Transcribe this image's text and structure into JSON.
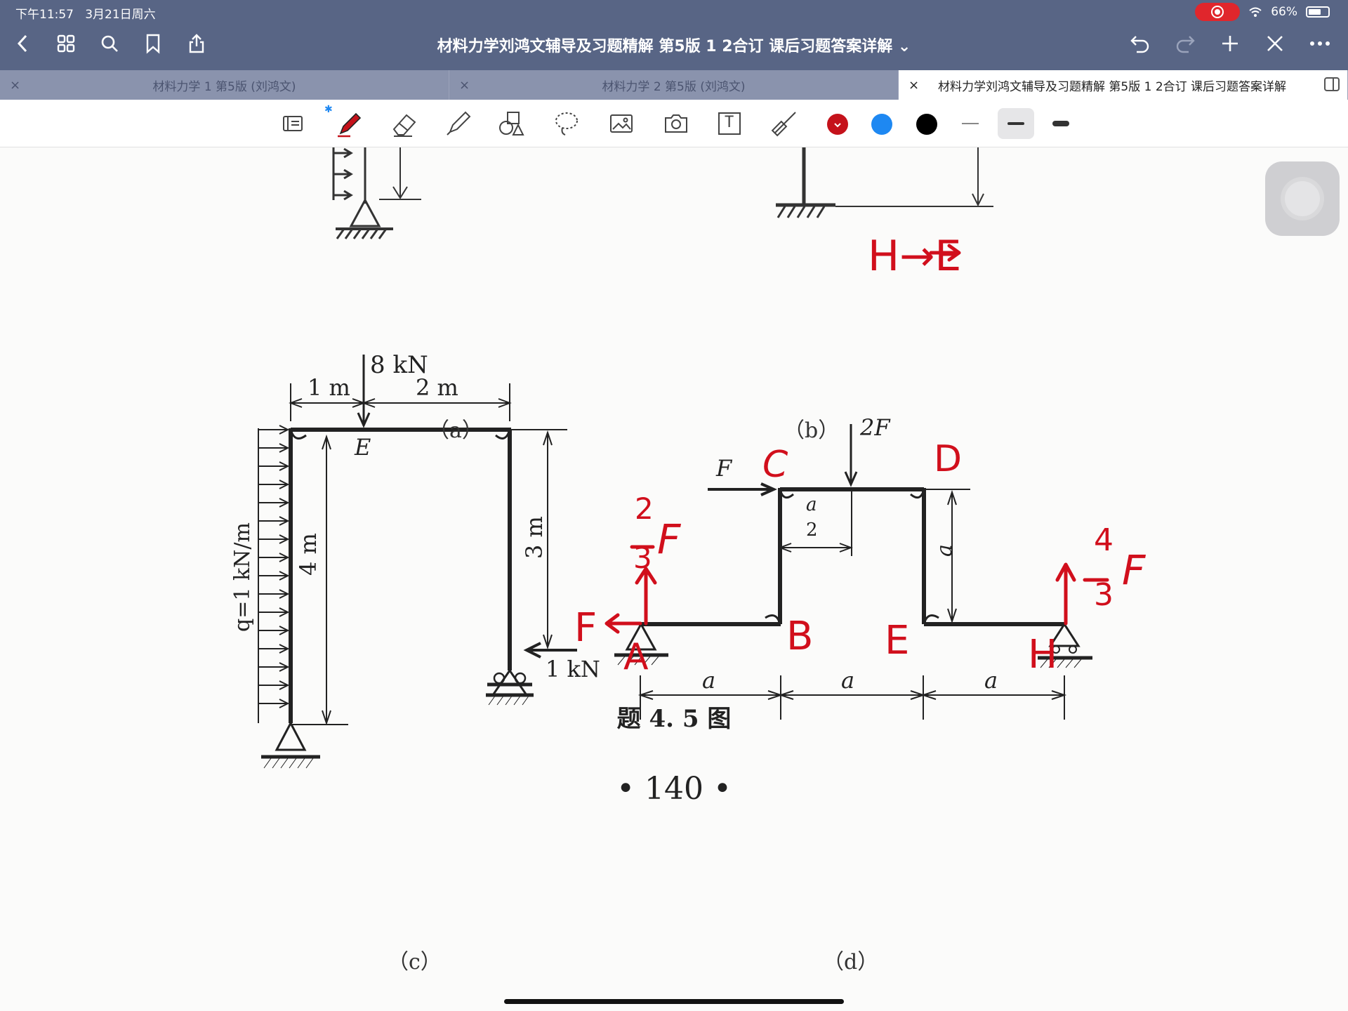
{
  "status": {
    "time": "下午11:57",
    "date": "3月21日周六",
    "battery": "66%",
    "battery_level": 0.66
  },
  "nav": {
    "title": "材料力学刘鸿文辅导及习题精解 第5版 1 2合订 课后习题答案详解",
    "title_chevron": "⌄"
  },
  "tabs": [
    {
      "label": "材料力学 1 第5版 (刘鸿文)",
      "close": "×"
    },
    {
      "label": "材料力学 2 第5版 (刘鸿文)",
      "close": "×"
    },
    {
      "label": "材料力学刘鸿文辅导及习题精解 第5版 1 2合订 课后习题答案详解",
      "close": "×"
    }
  ],
  "toolbar": {
    "colors": [
      "#c5121b",
      "#1e88f2",
      "#000000"
    ],
    "bluetooth_glyph": "✱",
    "text_tool_glyph": "T"
  },
  "figure": {
    "captions": {
      "a": "（a）",
      "b": "（b）",
      "c": "（c）",
      "d": "（d）"
    },
    "title": "题 4. 5 图",
    "page_number": "• 140 •",
    "c": {
      "load_top": "8 kN",
      "dim_1m": "1 m",
      "dim_2m": "2 m",
      "label_E": "E",
      "dim_4m": "4 m",
      "dim_3m": "3 m",
      "q_label": "q=1 kN/m",
      "load_right": "1 kN"
    },
    "d": {
      "load_2F": "2F",
      "load_F": "F",
      "dim_a_half_num": "a",
      "dim_a_half_den": "2",
      "dim_a_vertical": "a",
      "dim_a1": "a",
      "dim_a2": "a",
      "dim_a3": "a"
    },
    "handwritten": {
      "h_to_e": "H→E",
      "C": "C",
      "D": "D",
      "A": "A",
      "B": "B",
      "E": "E",
      "H": "H",
      "reaction_A_vertical_num": "2",
      "reaction_A_vertical_den": "3",
      "reaction_A_vertical_F": "F",
      "reaction_A_horizontal": "F",
      "reaction_H_num": "4",
      "reaction_H_den": "3",
      "reaction_H_F": "F",
      "ink_color": "#d10f1c"
    }
  }
}
